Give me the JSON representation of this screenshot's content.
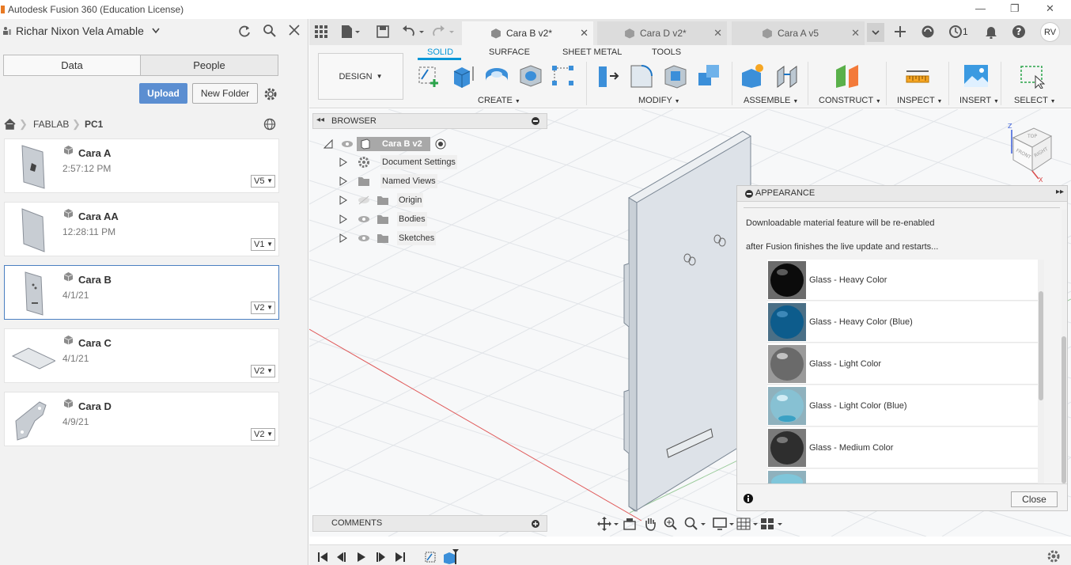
{
  "window": {
    "title": "Autodesk Fusion 360 (Education License)",
    "minimize": "—",
    "restore": "❐",
    "close": "✕"
  },
  "account": {
    "name": "Richar Nixon Vela Amable"
  },
  "left_tabs": {
    "data": "Data",
    "people": "People"
  },
  "actions": {
    "upload": "Upload",
    "new_folder": "New Folder"
  },
  "breadcrumb": {
    "root": "FABLAB",
    "folder": "PC1"
  },
  "files": [
    {
      "name": "Cara A",
      "time": "2:57:12 PM",
      "version": "V5"
    },
    {
      "name": "Cara AA",
      "time": "12:28:11 PM",
      "version": "V1"
    },
    {
      "name": "Cara B",
      "time": "4/1/21",
      "version": "V2"
    },
    {
      "name": "Cara C",
      "time": "4/1/21",
      "version": "V2"
    },
    {
      "name": "Cara D",
      "time": "4/9/21",
      "version": "V2"
    }
  ],
  "doc_tabs": [
    {
      "label": "Cara B v2*"
    },
    {
      "label": "Cara D v2*"
    },
    {
      "label": "Cara A v5"
    }
  ],
  "toolbar": {
    "jobs_count": "1",
    "user_initials": "RV"
  },
  "workspace": {
    "label": "DESIGN"
  },
  "ribbon_tabs": [
    "SOLID",
    "SURFACE",
    "SHEET METAL",
    "TOOLS"
  ],
  "ribbon_groups": [
    "CREATE",
    "MODIFY",
    "ASSEMBLE",
    "CONSTRUCT",
    "INSPECT",
    "INSERT",
    "SELECT"
  ],
  "browser": {
    "title": "BROWSER",
    "root": "Cara B v2",
    "items": [
      "Document Settings",
      "Named Views",
      "Origin",
      "Bodies",
      "Sketches"
    ]
  },
  "appearance": {
    "title": "APPEARANCE",
    "message_line1": "Downloadable material feature will be re-enabled",
    "message_line2": "after Fusion finishes the live update and restarts...",
    "materials": [
      "Glass - Heavy Color",
      "Glass - Heavy Color (Blue)",
      "Glass - Light Color",
      "Glass - Light Color (Blue)",
      "Glass - Medium Color"
    ],
    "close": "Close"
  },
  "comments": {
    "title": "COMMENTS"
  },
  "viewcube": {
    "top": "TOP",
    "front": "FRONT",
    "right": "RIGHT",
    "z": "Z",
    "x": "X"
  },
  "colors": {
    "accent": "#0696d7",
    "upload": "#5b8ed1",
    "selected_border": "#4a7fc1"
  }
}
